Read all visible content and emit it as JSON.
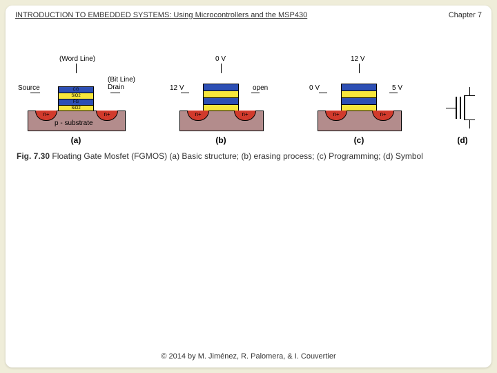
{
  "header": {
    "title": "INTRODUCTION TO EMBEDDED SYSTEMS: Using Microcontrollers and the MSP430",
    "chapter": "Chapter 7"
  },
  "figure": {
    "a": {
      "top_label": "(Word Line)",
      "left_label": "Source",
      "right_label": "(Bit Line)\nDrain",
      "layers": [
        "CG",
        "SiO2",
        "FG",
        "SiO2"
      ],
      "nplus": "n+",
      "substrate_text": "p - substrate",
      "sub": "(a)"
    },
    "b": {
      "top": "0 V",
      "left": "12 V",
      "right": "open",
      "nplus": "n+",
      "sub": "(b)"
    },
    "c": {
      "top": "12 V",
      "left": "0 V",
      "right": "5 V",
      "nplus": "n+",
      "sub": "(c)"
    },
    "d": {
      "sub": "(d)"
    },
    "caption_lead": "Fig. 7.30",
    "caption_body": " Floating Gate Mosfet (FGMOS) (a) Basic structure; (b) erasing process; (c) Programming; (d) Symbol"
  },
  "footer": {
    "copyright": "© 2014 by M. Jiménez, R. Palomera, & I. Couvertier"
  }
}
